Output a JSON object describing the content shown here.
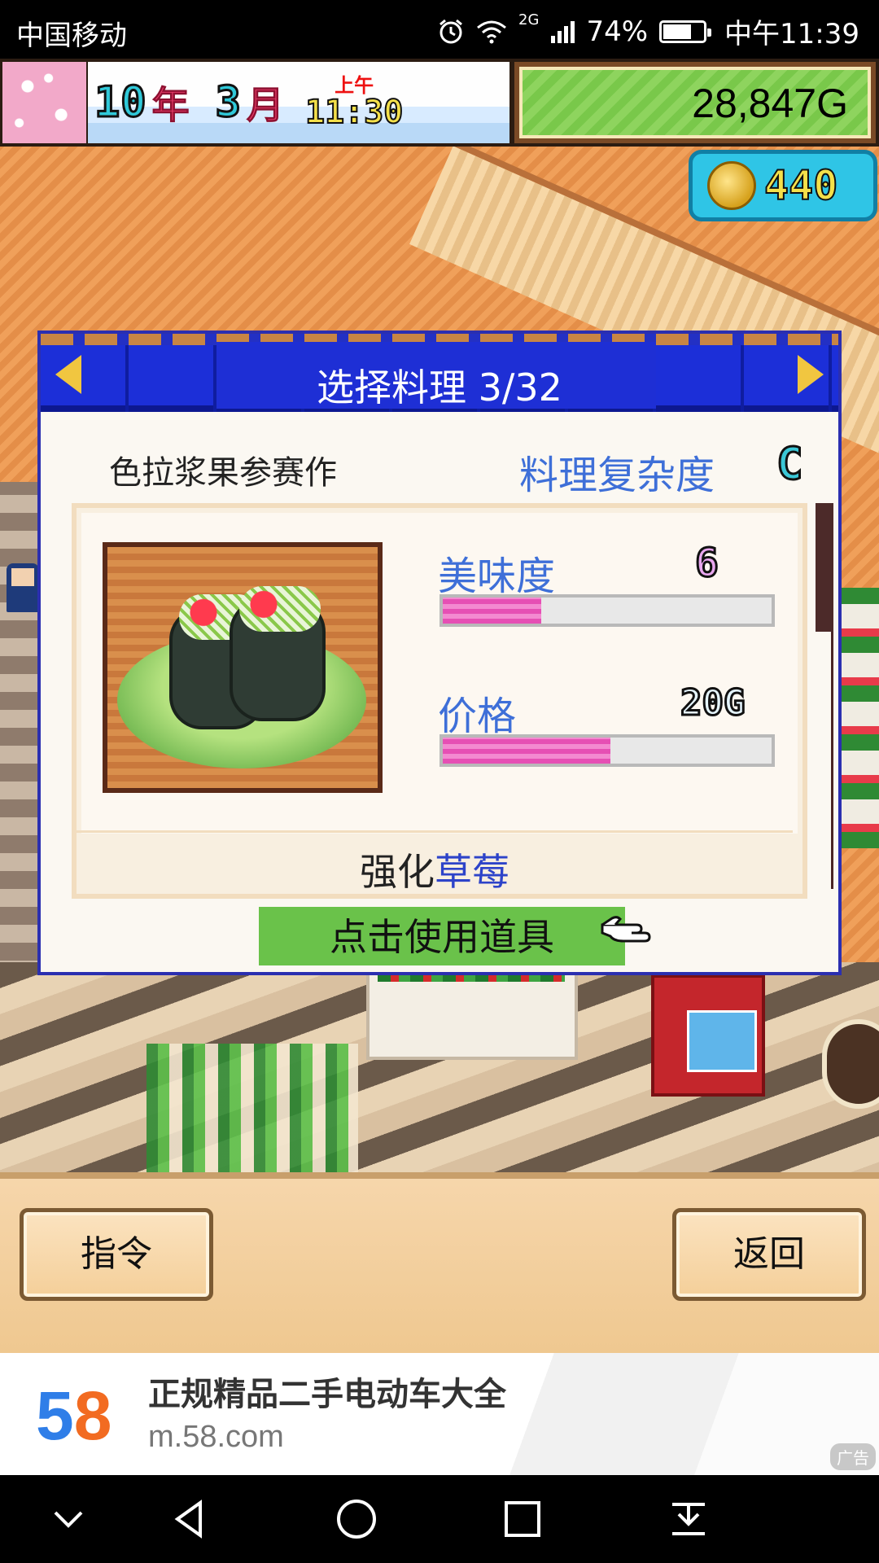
{
  "statusbar": {
    "carrier": "中国移动",
    "network": "2G",
    "battery_percent": "74%",
    "battery_level": 0.74,
    "time": "中午11:39",
    "icons": [
      "alarm-icon",
      "wifi-icon",
      "signal-icon",
      "battery-icon"
    ]
  },
  "hud": {
    "year": "10",
    "year_unit": "年",
    "month": "3",
    "month_unit": "月",
    "ampm": "上午",
    "time": "11:30",
    "money": "28,847G",
    "medals": "440"
  },
  "dialog": {
    "title": "选择料理 3/32",
    "entry_name": "色拉浆果参赛作",
    "complexity_label": "料理复杂度",
    "complexity_grade": "C",
    "taste_label": "美味度",
    "taste_value": "6",
    "taste_level": 0.3,
    "price_label": "价格",
    "price_value": "20G",
    "price_level": 0.51,
    "boost_prefix": "强化",
    "boost_item": "草莓",
    "use_item_button": "点击使用道具"
  },
  "commands": {
    "left": "指令",
    "right": "返回"
  },
  "ad": {
    "logo": "58",
    "title": "正规精品二手电动车大全",
    "url": "m.58.com",
    "tag": "广告"
  },
  "colors": {
    "dialog_border": "#2b2fb0",
    "accent_blue": "#3e6fd8",
    "bar_pink": "#e64fb4",
    "button_green": "#6ac24a"
  }
}
